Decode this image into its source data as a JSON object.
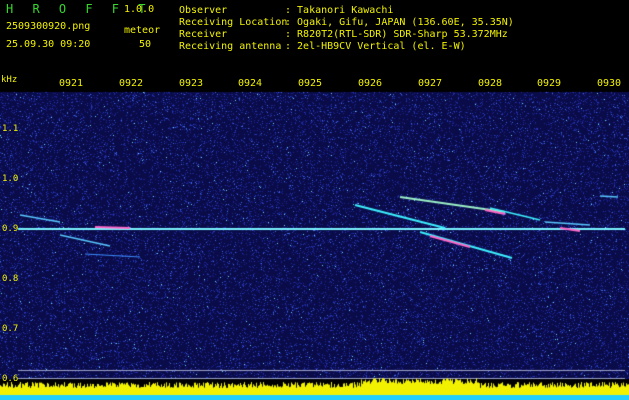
{
  "header": {
    "logo": "H R O F F T",
    "version": "1.0.0",
    "filename": "2509300920.png",
    "datetime": "25.09.30 09:20",
    "meteor_label": "meteor",
    "meteor_count": "50",
    "observer_label": "Observer",
    "observer_value": ": Takanori Kawachi",
    "location_label": "Receiving Location",
    "location_value": ": Ogaki, Gifu, JAPAN (136.60E, 35.35N)",
    "receiver_label": "Receiver",
    "receiver_value": ": R820T2(RTL-SDR) SDR-Sharp 53.372MHz",
    "antenna_label": "Receiving antenna",
    "antenna_value": ": 2el-HB9CV Vertical (el. E-W)"
  },
  "spectrogram": {
    "unit": "kHz",
    "time_ticks": [
      "0921",
      "0922",
      "0923",
      "0924",
      "0925",
      "0926",
      "0927",
      "0928",
      "0929",
      "0930"
    ],
    "freq_ticks": [
      "1.1",
      "1.0",
      "0.9",
      "0.8",
      "0.7",
      "0.6"
    ],
    "carrier_khz": 0.9,
    "colors": {
      "background": "#000000",
      "label": "#f2f200",
      "logo": "#37d72e",
      "noise": "#12186e",
      "signal": "#3cf0ff",
      "strong_signal": "#ff66c8",
      "activity_fill": "#f2f200",
      "activity_base": "#1fd0ff"
    }
  }
}
